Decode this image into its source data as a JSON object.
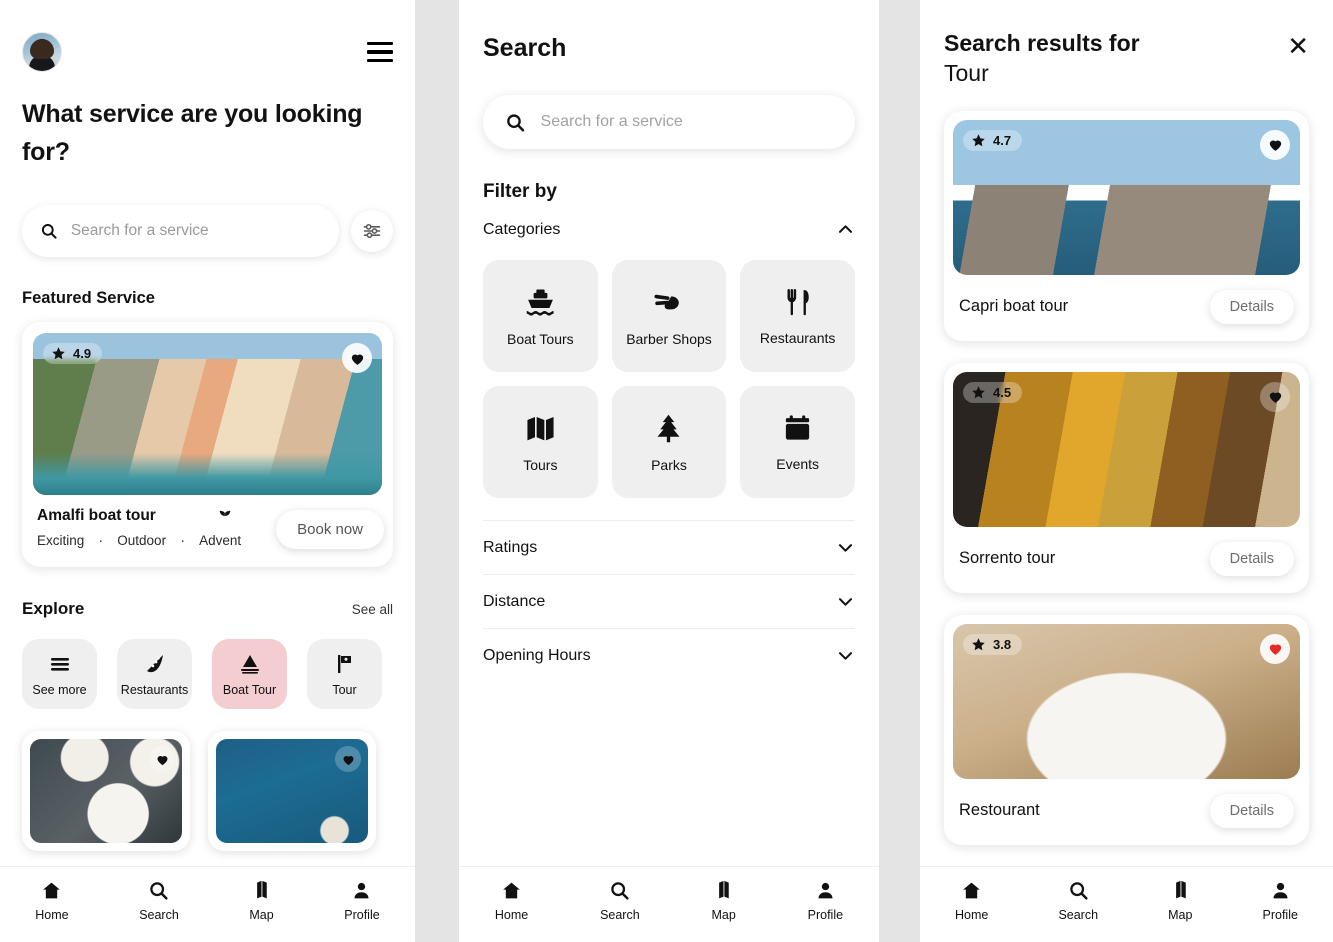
{
  "home": {
    "avatar_alt": "user avatar",
    "menu_icon": "hamburger-menu-icon",
    "hero_title": "What service are you looking for?",
    "search": {
      "placeholder": "Search for a service",
      "value": ""
    },
    "filter_icon": "tune-sliders-icon",
    "featured_label": "Featured Service",
    "featured_card": {
      "rating": "4.9",
      "title": "Amalfi boat tour",
      "leaf_icon": "leaf-sprout-icon",
      "tags": [
        "Exciting",
        "Outdoor",
        "Advent"
      ],
      "separator": "·",
      "book_label": "Book now",
      "favorited": true
    },
    "explore": {
      "title": "Explore",
      "see_all": "See all",
      "chips": [
        {
          "label": "See more",
          "icon": "menu-lines-icon",
          "active": false
        },
        {
          "label": "Restaurants",
          "icon": "pizza-slice-icon",
          "active": false
        },
        {
          "label": "Boat Tour",
          "icon": "sailboat-icon",
          "active": true
        },
        {
          "label": "Tour",
          "icon": "flag-icon",
          "active": false
        }
      ],
      "mini_cards": [
        {
          "image": "food-plates-photo",
          "favorited": true
        },
        {
          "image": "aerial-sea-boat-photo",
          "favorited": true
        }
      ]
    },
    "nav": [
      {
        "label": "Home",
        "icon": "home-icon"
      },
      {
        "label": "Search",
        "icon": "search-icon"
      },
      {
        "label": "Map",
        "icon": "map-icon"
      },
      {
        "label": "Profile",
        "icon": "person-icon"
      }
    ]
  },
  "search": {
    "title": "Search",
    "search_field": {
      "placeholder": "Search for a service",
      "value": ""
    },
    "filter_by": "Filter by",
    "categories_label": "Categories",
    "categories_expanded": true,
    "categories": [
      {
        "label": "Boat Tours",
        "icon": "ferry-boat-icon"
      },
      {
        "label": "Barber Shops",
        "icon": "scissors-hand-icon"
      },
      {
        "label": "Restaurants",
        "icon": "fork-knife-icon"
      },
      {
        "label": "Tours",
        "icon": "map-folded-icon"
      },
      {
        "label": "Parks",
        "icon": "tree-icon"
      },
      {
        "label": "Events",
        "icon": "calendar-icon"
      }
    ],
    "filters": [
      {
        "label": "Ratings",
        "expanded": false
      },
      {
        "label": "Distance",
        "expanded": false
      },
      {
        "label": "Opening Hours",
        "expanded": false
      }
    ],
    "nav": [
      {
        "label": "Home",
        "icon": "home-icon"
      },
      {
        "label": "Search",
        "icon": "search-icon"
      },
      {
        "label": "Map",
        "icon": "map-icon"
      },
      {
        "label": "Profile",
        "icon": "person-icon"
      }
    ]
  },
  "results": {
    "heading": "Search results for",
    "query": "Tour",
    "close_icon": "close-x-icon",
    "details_label": "Details",
    "cards": [
      {
        "rating": "4.7",
        "title": "Capri boat tour",
        "favorited": true,
        "heart_color": "#111111",
        "image": "capri-faraglioni-photo"
      },
      {
        "rating": "4.5",
        "title": "Sorrento tour",
        "favorited": true,
        "heart_color": "#111111",
        "image": "sorrento-street-photo"
      },
      {
        "rating": "3.8",
        "title": "Restourant",
        "favorited": true,
        "heart_color": "#e52b25",
        "image": "pasta-dish-photo"
      }
    ],
    "nav": [
      {
        "label": "Home",
        "icon": "home-icon"
      },
      {
        "label": "Search",
        "icon": "search-icon"
      },
      {
        "label": "Map",
        "icon": "map-icon"
      },
      {
        "label": "Profile",
        "icon": "person-icon"
      }
    ]
  },
  "theme": {
    "background": "#e4e4e4",
    "panel": "#ffffff",
    "chip_bg": "#efefef",
    "chip_active_bg": "#f3cdd0",
    "text": "#111111",
    "muted": "#6d6d6d",
    "heart_red": "#e52b25"
  }
}
